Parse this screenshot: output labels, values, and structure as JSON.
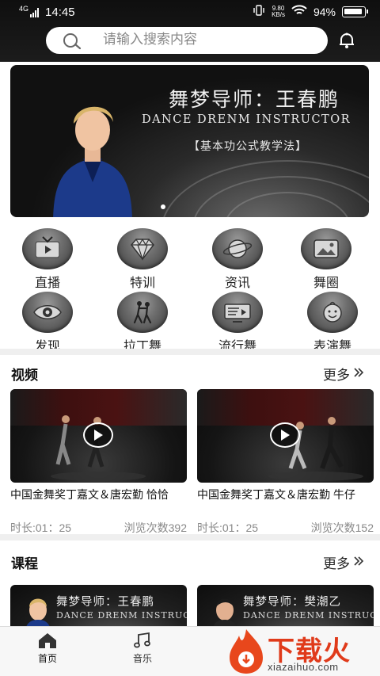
{
  "status_bar": {
    "network": "4G",
    "time": "14:45",
    "speed_value": "9.80",
    "speed_unit": "KB/s",
    "battery": "94%"
  },
  "search": {
    "placeholder": "请输入搜索内容",
    "icon": "search-icon",
    "notification_icon": "bell-icon"
  },
  "banner": {
    "title": "舞梦导师：王春鹏",
    "subtitle": "DANCE DRENM INSTRUCTOR",
    "tag": "【基本功公式教学法】"
  },
  "categories": [
    {
      "label": "直播",
      "icon": "tv-icon"
    },
    {
      "label": "特训",
      "icon": "diamond-icon"
    },
    {
      "label": "资讯",
      "icon": "planet-icon"
    },
    {
      "label": "舞圈",
      "icon": "image-icon"
    },
    {
      "label": "发现",
      "icon": "eye-icon"
    },
    {
      "label": "拉丁舞",
      "icon": "dancer-icon"
    },
    {
      "label": "流行舞",
      "icon": "screen-icon"
    },
    {
      "label": "表演舞",
      "icon": "smile-icon"
    }
  ],
  "videos_section": {
    "title": "视频",
    "more": "更多",
    "items": [
      {
        "title": "中国金舞奖丁嘉文＆唐宏勤 恰恰",
        "duration": "时长:01：25",
        "views": "浏览次数392"
      },
      {
        "title": "中国金舞奖丁嘉文＆唐宏勤 牛仔",
        "duration": "时长:01：25",
        "views": "浏览次数152"
      }
    ]
  },
  "courses_section": {
    "title": "课程",
    "more": "更多",
    "items": [
      {
        "title": "舞梦导师：王春鹏",
        "subtitle": "DANCE DRENM INSTRUCTOR"
      },
      {
        "title": "舞梦导师：樊潮乙",
        "subtitle": "DANCE DRENM INSTRUCTOR"
      }
    ]
  },
  "bottom_nav": [
    {
      "label": "首页",
      "icon": "home-icon",
      "active": true
    },
    {
      "label": "音乐",
      "icon": "music-note-icon",
      "active": false
    }
  ],
  "watermark": {
    "title": "下载火",
    "url": "xiazaihuo.com"
  }
}
